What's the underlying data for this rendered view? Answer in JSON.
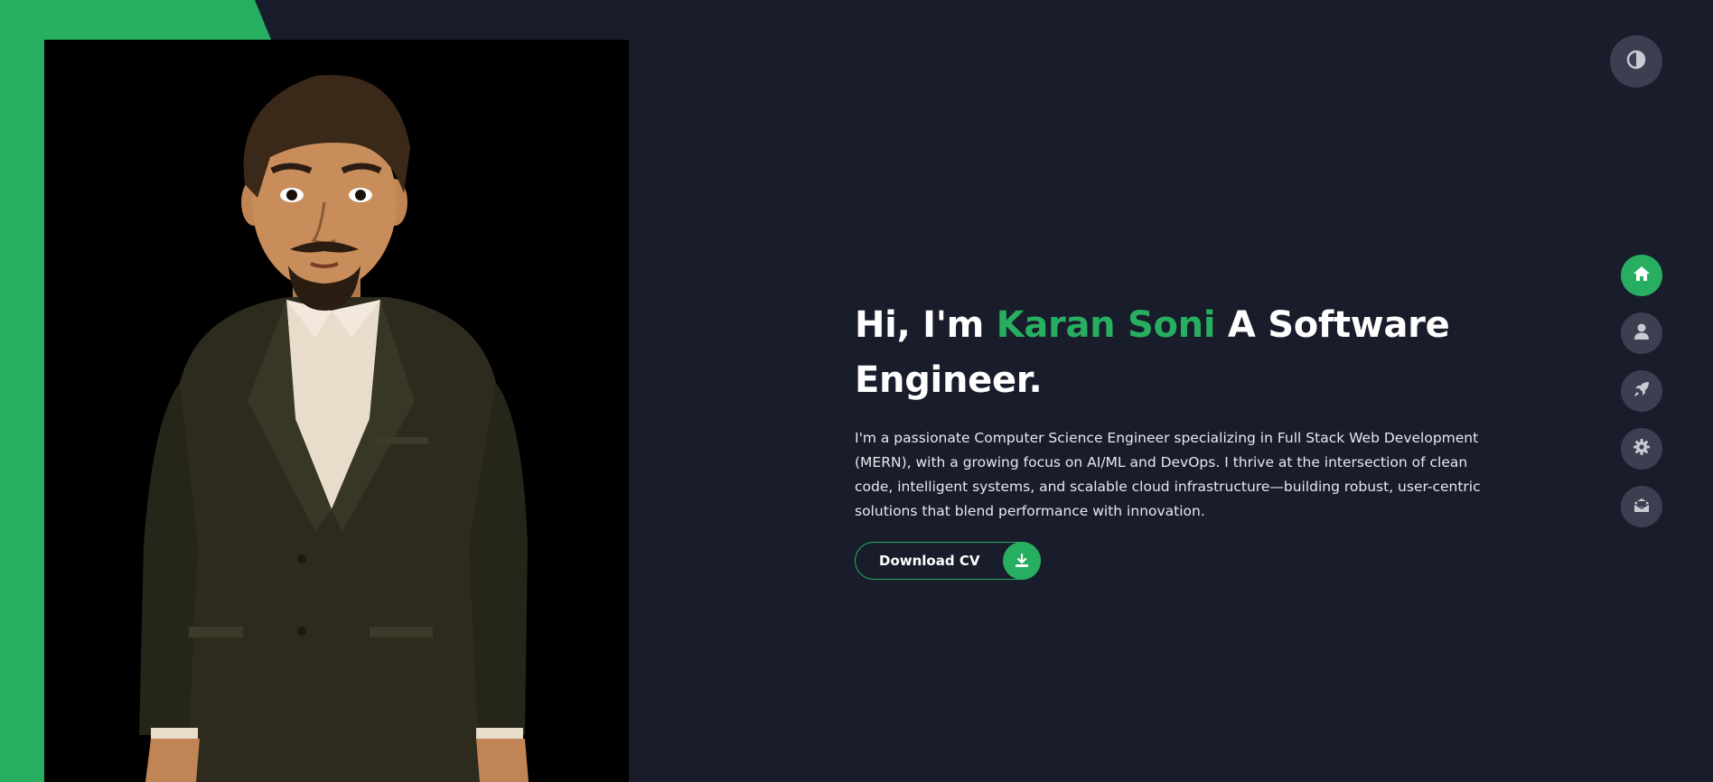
{
  "hero": {
    "greeting": "Hi, I'm",
    "name": "Karan Soni",
    "role": "A Software Engineer.",
    "description": "I'm a passionate Computer Science Engineer specializing in Full Stack Web Development (MERN), with a growing focus on AI/ML and DevOps. I thrive at the intersection of clean code, intelligent systems, and scalable cloud infrastructure—building robust, user-centric solutions that blend performance with innovation.",
    "cv_button_label": "Download CV"
  },
  "colors": {
    "accent": "#27ae60",
    "background": "#191c2a",
    "nav_button": "#3b3f4f"
  },
  "icons": {
    "theme_toggle": "half-circle-contrast-icon",
    "cv_download": "download-icon",
    "nav": [
      "home-icon",
      "user-icon",
      "rocket-icon",
      "gear-icon",
      "envelope-open-icon"
    ]
  },
  "nav": {
    "active_item": "home"
  }
}
